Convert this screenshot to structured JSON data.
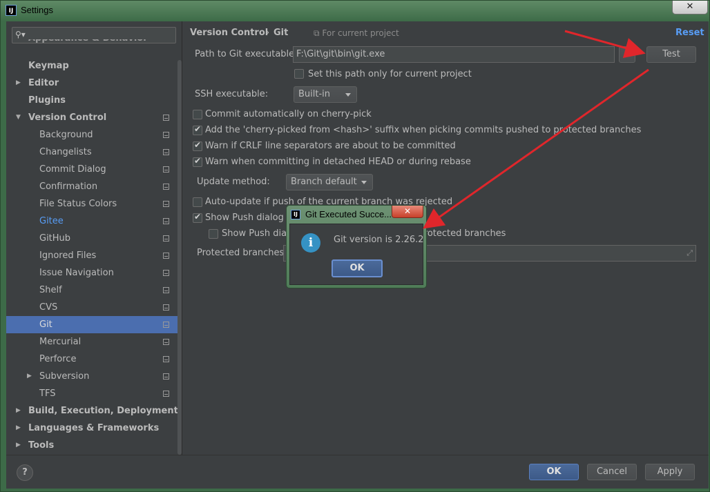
{
  "window": {
    "title": "Settings",
    "logo": "IJ",
    "close_glyph": "✕"
  },
  "search": {
    "placeholder": "",
    "icon": "search-icon"
  },
  "sidebar": {
    "cut_top_item": "Appearance & Behavior",
    "items": [
      {
        "label": "Keymap"
      },
      {
        "label": "Editor"
      },
      {
        "label": "Plugins"
      },
      {
        "label": "Version Control"
      },
      {
        "label": "Background"
      },
      {
        "label": "Changelists"
      },
      {
        "label": "Commit Dialog"
      },
      {
        "label": "Confirmation"
      },
      {
        "label": "File Status Colors"
      },
      {
        "label": "Gitee"
      },
      {
        "label": "GitHub"
      },
      {
        "label": "Ignored Files"
      },
      {
        "label": "Issue Navigation"
      },
      {
        "label": "Shelf"
      },
      {
        "label": "CVS"
      },
      {
        "label": "Git"
      },
      {
        "label": "Mercurial"
      },
      {
        "label": "Perforce"
      },
      {
        "label": "Subversion"
      },
      {
        "label": "TFS"
      },
      {
        "label": "Build, Execution, Deployment"
      },
      {
        "label": "Languages & Frameworks"
      },
      {
        "label": "Tools"
      }
    ]
  },
  "breadcrumb": {
    "parent": "Version Control",
    "separator": "›",
    "current": "Git",
    "scope": "For current project",
    "reset": "Reset"
  },
  "git": {
    "path_label": "Path to Git executable:",
    "path_value": "F:\\Git\\git\\bin\\git.exe",
    "browse_label": "...",
    "test_label": "Test",
    "current_project_only": "Set this path only for current project",
    "ssh_label": "SSH executable:",
    "ssh_value": "Built-in",
    "commit_cherry_pick": "Commit automatically on cherry-pick",
    "cherry_suffix": "Add the 'cherry-picked from <hash>' suffix when picking commits pushed to protected branches",
    "warn_crlf": "Warn if CRLF line separators are about to be committed",
    "warn_detached": "Warn when committing in detached HEAD or during rebase",
    "update_method_label": "Update method:",
    "update_method_value": "Branch default",
    "auto_update": "Auto-update if push of the current branch was rejected",
    "show_push": "Show Push dialog for Commit and Push",
    "show_push_protected": "Show Push dialog only when committing to protected branches",
    "protected_label": "Protected branches:",
    "protected_value": ""
  },
  "dialog": {
    "title": "Git Executed Succe...",
    "message": "Git version is 2.26.2",
    "ok": "OK",
    "close": "✕",
    "icon": "info-icon",
    "icon_glyph": "i"
  },
  "footer": {
    "help": "?",
    "ok": "OK",
    "cancel": "Cancel",
    "apply": "Apply"
  },
  "colors": {
    "accent": "#4b6eaf",
    "link": "#589df6",
    "arrow": "#e0262b"
  }
}
